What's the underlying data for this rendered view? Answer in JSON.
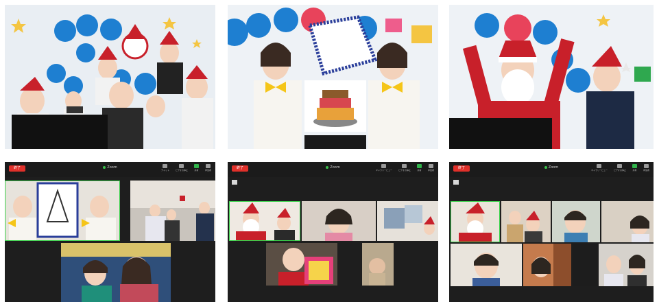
{
  "photos": [
    {
      "name": "photo-ouchi-de-christmas-group"
    },
    {
      "name": "photo-cake-drawing-presentation"
    },
    {
      "name": "photo-santa-waving"
    }
  ],
  "zoom_screens": [
    {
      "end_label": "終了",
      "meeting_title": "Zoom",
      "meeting_sub": "",
      "tools": [
        "チャット",
        "ビデオの停止",
        "共有",
        "参加者"
      ],
      "share_label": ""
    },
    {
      "end_label": "終了",
      "meeting_title": "Zoom",
      "meeting_sub": "",
      "tools": [
        "",
        "ギャラリービュー",
        "ビデオの停止",
        "共有",
        "参加者"
      ],
      "share_label": ""
    },
    {
      "end_label": "終了",
      "meeting_title": "Zoom",
      "meeting_sub": "",
      "tools": [
        "",
        "ギャラリービュー",
        "ビデオの停止",
        "共有",
        "参加者"
      ],
      "share_label": ""
    }
  ],
  "colors": {
    "zoom_bg": "#1e1e1e",
    "end_red": "#e0302a",
    "active_green": "#39d24a",
    "balloon_blue": "#1e7fd1",
    "santa_red": "#c8202a"
  }
}
